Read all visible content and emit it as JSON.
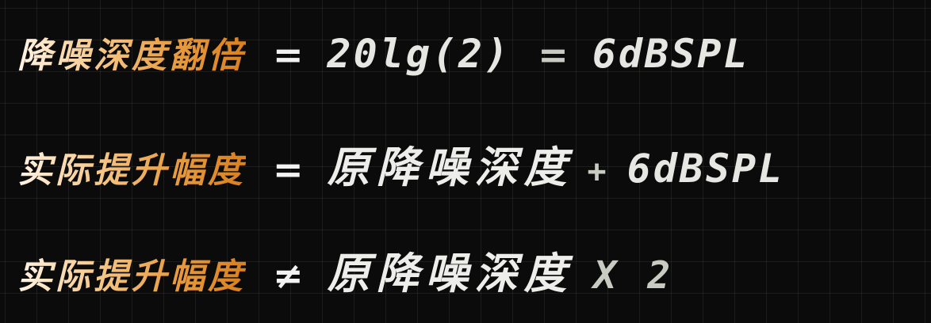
{
  "lines": [
    {
      "label": "降噪深度翻倍",
      "operator": "=",
      "formula": "20lg(2)",
      "equals": "=",
      "result": "6dBSPL"
    },
    {
      "label": "实际提升幅度",
      "operator": "=",
      "term": "原降噪深度",
      "plus": "+",
      "result": "6dBSPL"
    },
    {
      "label": "实际提升幅度",
      "operator": "≠",
      "term": "原降噪深度",
      "multiplier": "X 2"
    }
  ],
  "colors": {
    "background": "#0b0b0b",
    "label_gradient_start": "#fff4e6",
    "label_gradient_end": "#d9801f",
    "text_light": "#ededea",
    "text_muted": "#c8cbc2"
  }
}
